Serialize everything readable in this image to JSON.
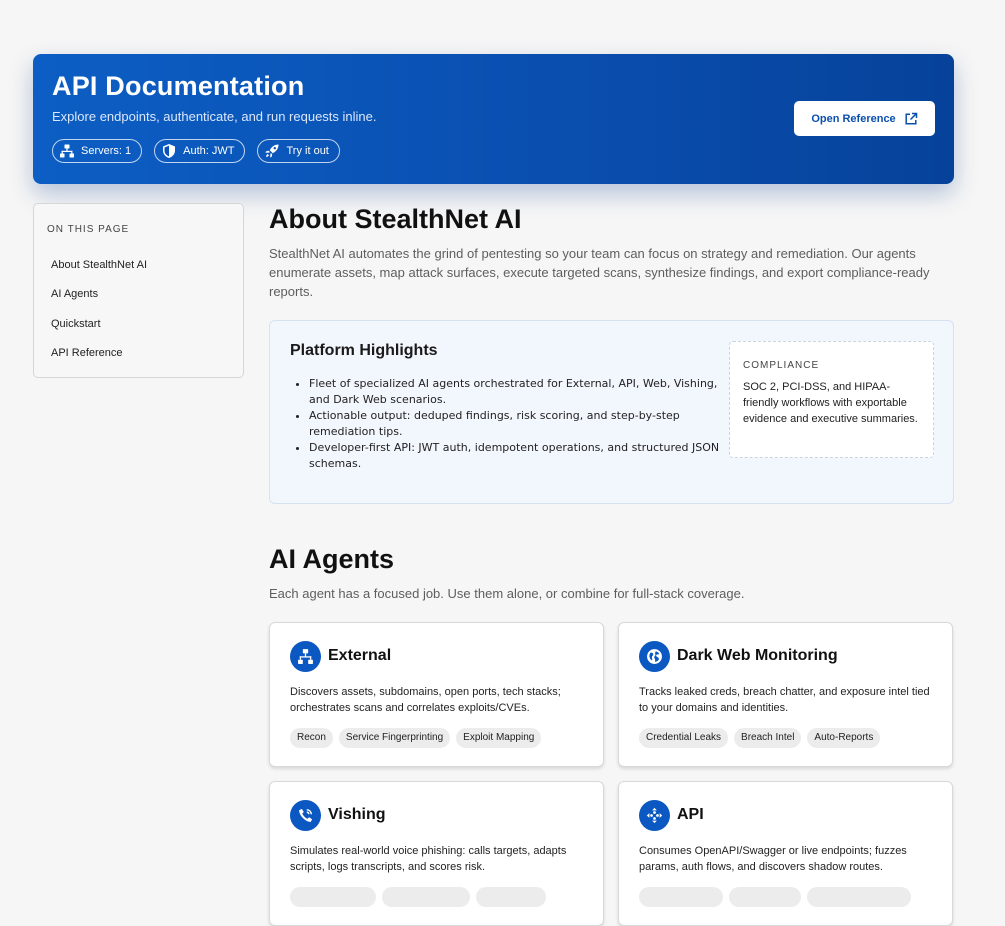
{
  "header": {
    "title": "API Documentation",
    "subtitle": "Explore endpoints, authenticate, and run requests inline.",
    "pills": [
      {
        "label": "Servers: 1",
        "icon": "sitemap-icon"
      },
      {
        "label": "Auth: JWT",
        "icon": "shield-icon"
      },
      {
        "label": "Try it out",
        "icon": "rocket-icon"
      }
    ],
    "open_reference_label": "Open Reference",
    "brand_color": "#0b58c2"
  },
  "toc": {
    "title": "ON THIS PAGE",
    "items": [
      "About StealthNet AI",
      "AI Agents",
      "Quickstart",
      "API Reference"
    ]
  },
  "about": {
    "title": "About StealthNet AI",
    "lead": "StealthNet AI automates the grind of pentesting so your team can focus on strategy and remediation. Our agents enumerate assets, map attack surfaces, execute targeted scans, synthesize findings, and export compliance-ready reports.",
    "highlights": {
      "title": "Platform Highlights",
      "bullets": [
        "Fleet of specialized AI agents orchestrated for External, API, Web, Vishing, and Dark Web scenarios.",
        "Actionable output: deduped findings, risk scoring, and step-by-step remediation tips.",
        "Developer-first API: JWT auth, idempotent operations, and structured JSON schemas."
      ],
      "compliance": {
        "title": "COMPLIANCE",
        "body": "SOC 2, PCI-DSS, and HIPAA-friendly workflows with exportable evidence and executive summaries."
      }
    }
  },
  "agents": {
    "title": "AI Agents",
    "lead": "Each agent has a focused job. Use them alone, or combine for full-stack coverage.",
    "cards": [
      {
        "name": "External",
        "icon": "sitemap-icon",
        "description": "Discovers assets, subdomains, open ports, tech stacks; orchestrates scans and correlates exploits/CVEs.",
        "tags": [
          "Recon",
          "Service Fingerprinting",
          "Exploit Mapping"
        ]
      },
      {
        "name": "Dark Web Monitoring",
        "icon": "globe-icon",
        "description": "Tracks leaked creds, breach chatter, and exposure intel tied to your domains and identities.",
        "tags": [
          "Credential Leaks",
          "Breach Intel",
          "Auto-Reports"
        ]
      },
      {
        "name": "Vishing",
        "icon": "phone-icon",
        "description": "Simulates real-world voice phishing: calls targets, adapts scripts, logs transcripts, and scores risk.",
        "tags": []
      },
      {
        "name": "API",
        "icon": "network-diamond-icon",
        "description": "Consumes OpenAPI/Swagger or live endpoints; fuzzes params, auth flows, and discovers shadow routes.",
        "tags": []
      }
    ]
  }
}
